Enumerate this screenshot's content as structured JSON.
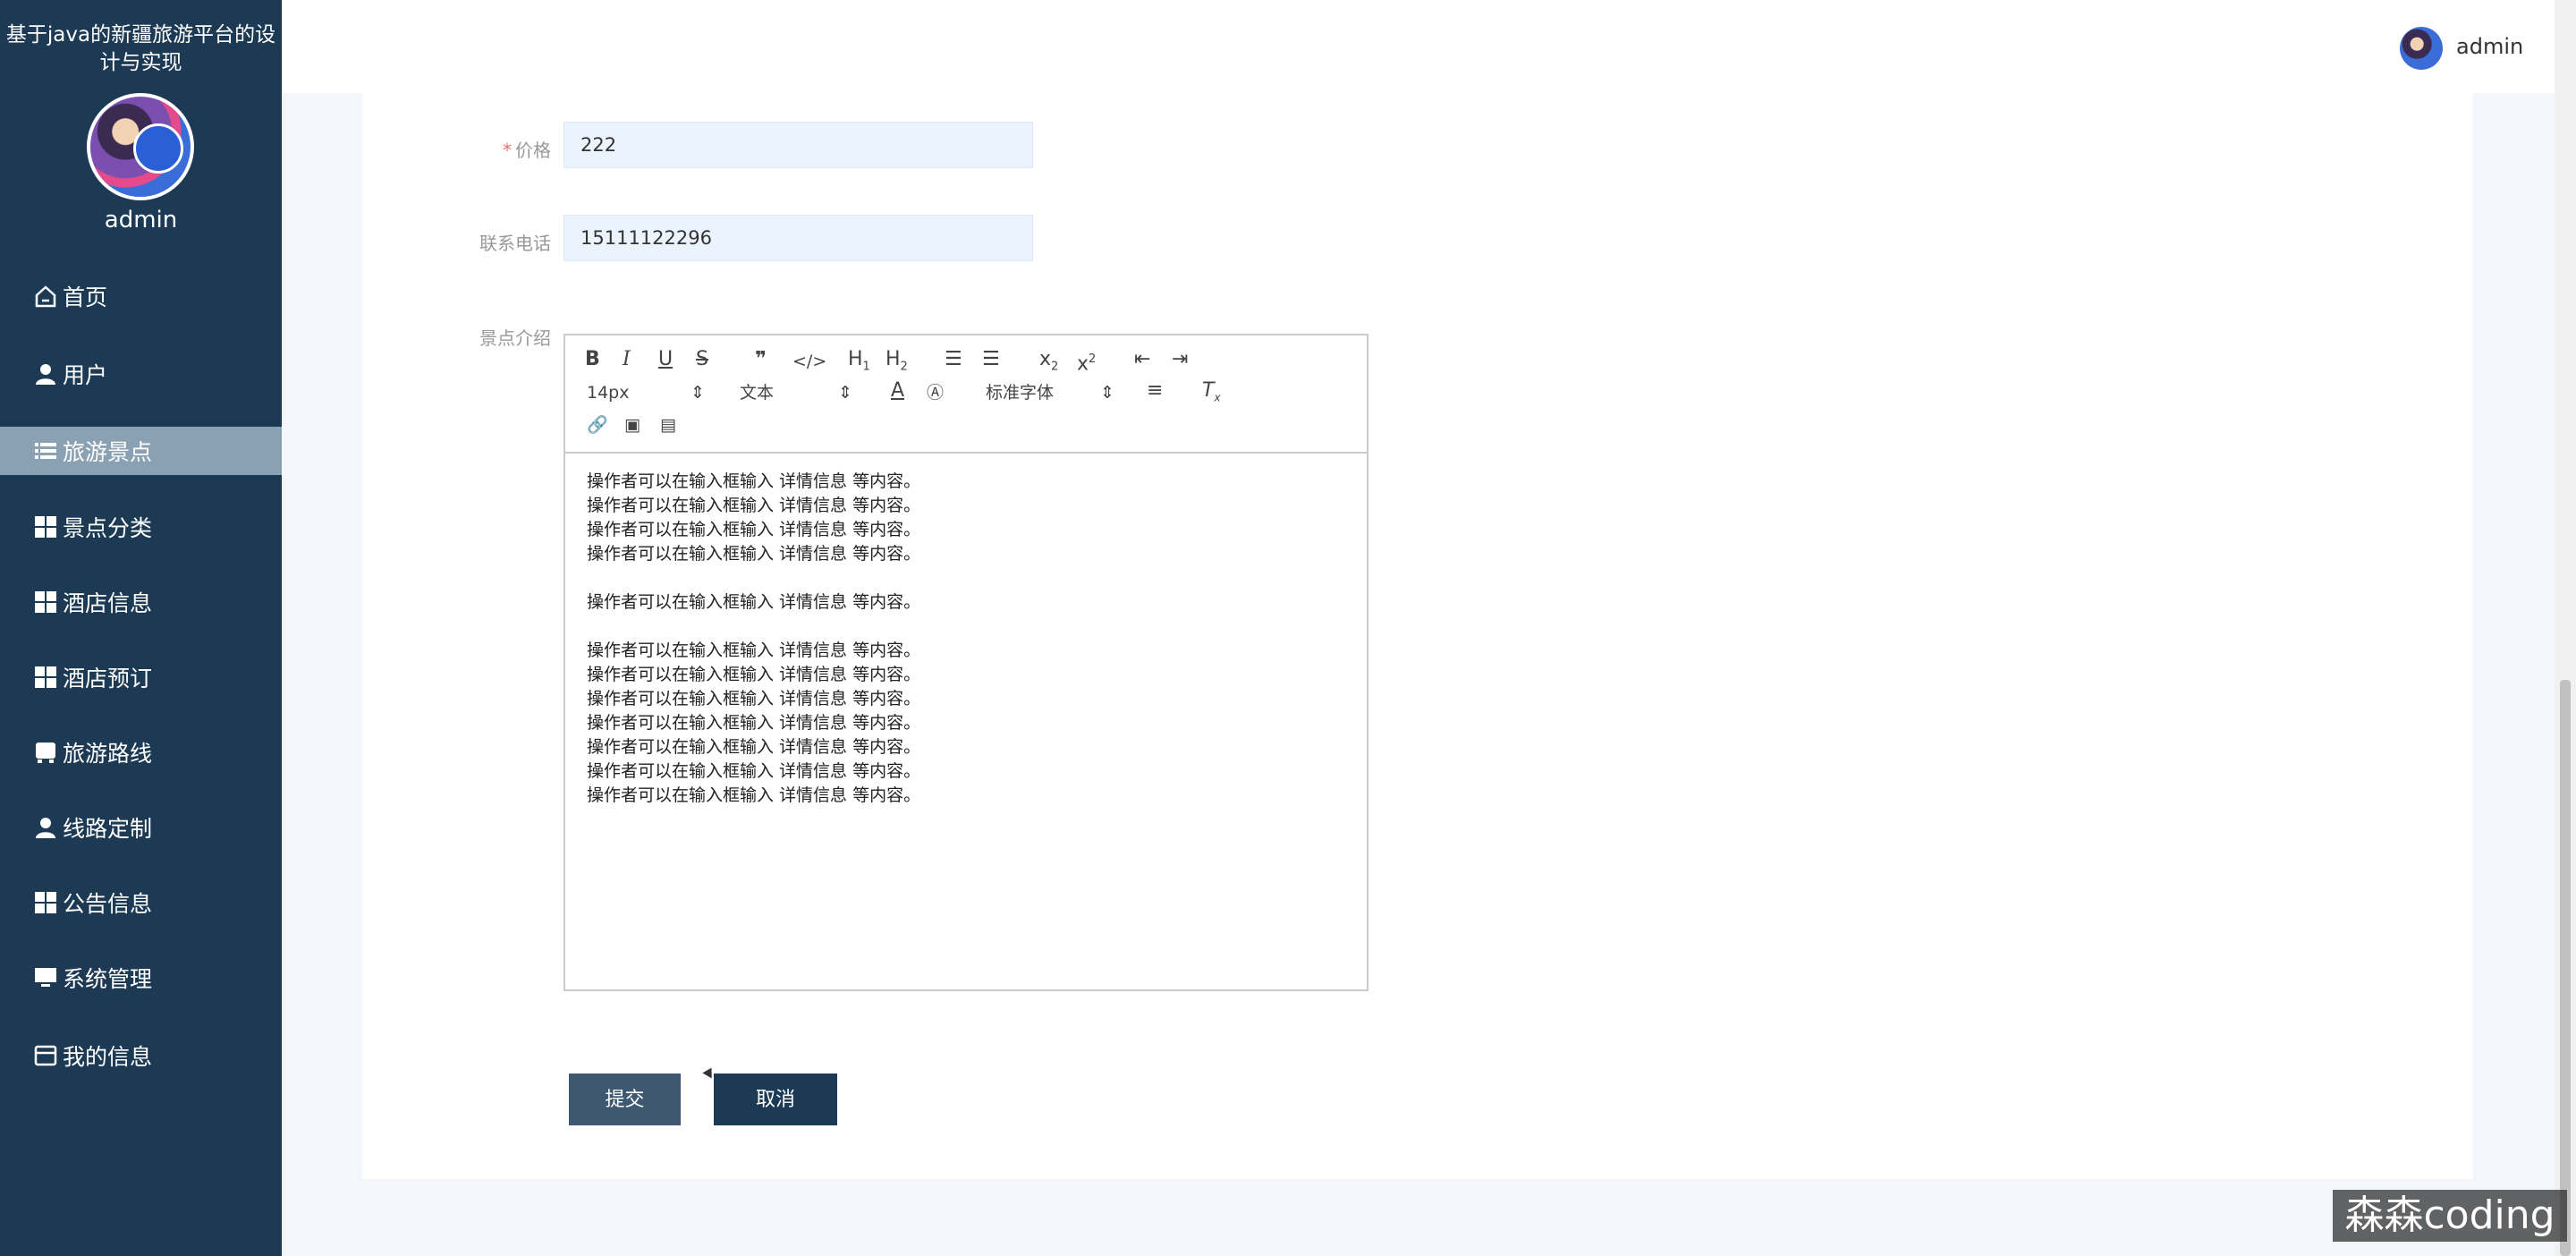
{
  "sidebar": {
    "title": "基于java的新疆旅游平台的设计与实现",
    "username": "admin",
    "items": [
      {
        "label": "首页",
        "icon": "home-icon"
      },
      {
        "label": "用户",
        "icon": "user-icon"
      },
      {
        "label": "旅游景点",
        "icon": "list-icon",
        "active": true
      },
      {
        "label": "景点分类",
        "icon": "grid-icon"
      },
      {
        "label": "酒店信息",
        "icon": "grid-icon"
      },
      {
        "label": "酒店预订",
        "icon": "grid-icon"
      },
      {
        "label": "旅游路线",
        "icon": "bus-icon"
      },
      {
        "label": "线路定制",
        "icon": "user-icon"
      },
      {
        "label": "公告信息",
        "icon": "grid-icon"
      },
      {
        "label": "系统管理",
        "icon": "monitor-icon"
      },
      {
        "label": "我的信息",
        "icon": "card-icon"
      }
    ]
  },
  "header": {
    "username": "admin"
  },
  "form": {
    "price_label": "价格",
    "price_value": "222",
    "phone_label": "联系电话",
    "phone_value": "15111122296",
    "intro_label": "景点介绍",
    "editor": {
      "font_size": "14px",
      "block_type": "文本",
      "font_family": "标准字体",
      "lines": [
        "操作者可以在输入框输入 详情信息 等内容。",
        "操作者可以在输入框输入 详情信息 等内容。",
        "操作者可以在输入框输入 详情信息 等内容。",
        "操作者可以在输入框输入 详情信息 等内容。",
        "",
        "操作者可以在输入框输入 详情信息 等内容。",
        "",
        "操作者可以在输入框输入 详情信息 等内容。",
        "操作者可以在输入框输入 详情信息 等内容。",
        "操作者可以在输入框输入 详情信息 等内容。",
        "操作者可以在输入框输入 详情信息 等内容。",
        "操作者可以在输入框输入 详情信息 等内容。",
        "操作者可以在输入框输入 详情信息 等内容。",
        "操作者可以在输入框输入 详情信息 等内容。"
      ]
    },
    "submit_label": "提交",
    "cancel_label": "取消"
  },
  "watermark": "森森coding",
  "colors": {
    "sidebar_bg": "#1d3a54",
    "active_item_bg": "#8aa1b3",
    "input_bg": "#ebf4fc",
    "submit_bg": "#3d5870",
    "cancel_bg": "#1d3a54"
  }
}
